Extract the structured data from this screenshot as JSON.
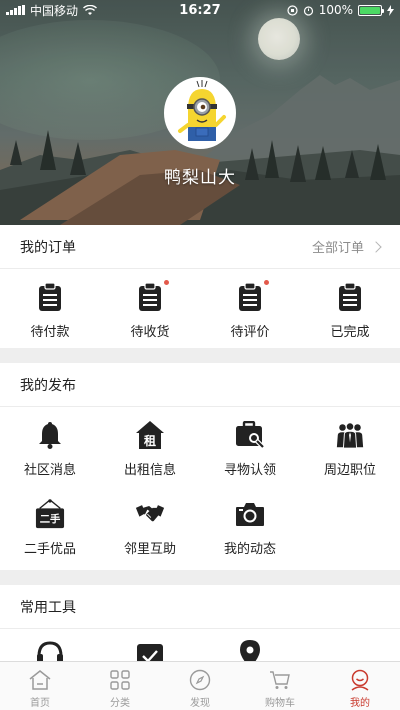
{
  "status_bar": {
    "carrier": "中国移动",
    "time": "16:27",
    "battery": "100%"
  },
  "profile": {
    "username": "鸭梨山大"
  },
  "orders": {
    "title": "我的订单",
    "more_label": "全部订单",
    "items": [
      {
        "label": "待付款",
        "badge": false
      },
      {
        "label": "待收货",
        "badge": true
      },
      {
        "label": "待评价",
        "badge": true
      },
      {
        "label": "已完成",
        "badge": false
      }
    ]
  },
  "posts": {
    "title": "我的发布",
    "items": [
      {
        "label": "社区消息",
        "icon": "bell-icon"
      },
      {
        "label": "出租信息",
        "icon": "house-rent-icon",
        "icon_text": "租"
      },
      {
        "label": "寻物认领",
        "icon": "briefcase-search-icon"
      },
      {
        "label": "周边职位",
        "icon": "people-icon"
      },
      {
        "label": "二手优品",
        "icon": "second-hand-sign-icon",
        "icon_text": "二手"
      },
      {
        "label": "邻里互助",
        "icon": "handshake-icon"
      },
      {
        "label": "我的动态",
        "icon": "camera-icon"
      }
    ]
  },
  "tools": {
    "title": "常用工具"
  },
  "tabbar": {
    "items": [
      {
        "label": "首页",
        "icon": "home-icon"
      },
      {
        "label": "分类",
        "icon": "grid-icon"
      },
      {
        "label": "发现",
        "icon": "compass-icon"
      },
      {
        "label": "购物车",
        "icon": "cart-icon"
      },
      {
        "label": "我的",
        "icon": "profile-icon",
        "active": true
      }
    ]
  },
  "colors": {
    "accent": "#c93a2e",
    "badge": "#e35a4b",
    "icon_dark": "#222222"
  }
}
